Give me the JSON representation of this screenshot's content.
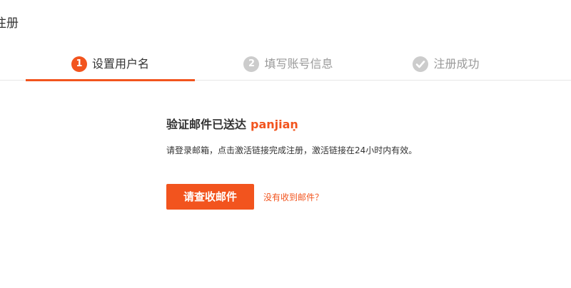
{
  "page": {
    "title": "注册"
  },
  "steps": [
    {
      "number": "1",
      "label": "设置用户名",
      "state": "active"
    },
    {
      "number": "2",
      "label": "填写账号信息",
      "state": "inactive"
    },
    {
      "number": "",
      "icon": "checkmark-icon",
      "label": "注册成功",
      "state": "inactive"
    }
  ],
  "main": {
    "sent_text": "验证邮件已送达",
    "username": "panjiaṇ",
    "instruction": "请登录邮箱，点击激活链接完成注册，激活链接在24小时内有效。",
    "check_email_label": "请查收邮件",
    "not_received_label": "没有收到邮件？"
  },
  "colors": {
    "accent": "#f2541e",
    "inactive": "#cccccc",
    "divider": "#e6e6e6"
  }
}
